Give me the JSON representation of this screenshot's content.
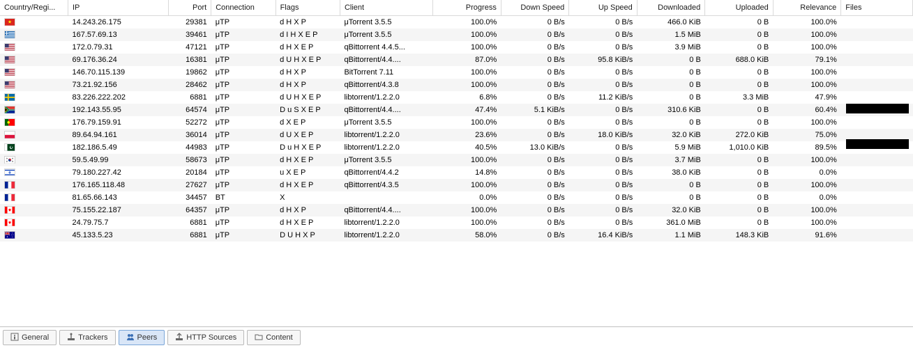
{
  "columns": [
    {
      "key": "country",
      "label": "Country/Regi...",
      "align": "left",
      "width": 95
    },
    {
      "key": "ip",
      "label": "IP",
      "align": "left",
      "width": 140
    },
    {
      "key": "port",
      "label": "Port",
      "align": "right",
      "width": 60
    },
    {
      "key": "connection",
      "label": "Connection",
      "align": "left",
      "width": 90
    },
    {
      "key": "flags",
      "label": "Flags",
      "align": "left",
      "width": 90
    },
    {
      "key": "client",
      "label": "Client",
      "align": "left",
      "width": 130
    },
    {
      "key": "progress",
      "label": "Progress",
      "align": "right",
      "width": 95
    },
    {
      "key": "down",
      "label": "Down Speed",
      "align": "right",
      "width": 95
    },
    {
      "key": "up",
      "label": "Up Speed",
      "align": "right",
      "width": 95
    },
    {
      "key": "downloaded",
      "label": "Downloaded",
      "align": "right",
      "width": 95
    },
    {
      "key": "uploaded",
      "label": "Uploaded",
      "align": "right",
      "width": 95
    },
    {
      "key": "relevance",
      "label": "Relevance",
      "align": "right",
      "width": 95
    },
    {
      "key": "files",
      "label": "Files",
      "align": "left",
      "width": 100
    }
  ],
  "rows": [
    {
      "flag": "vn",
      "ip": "14.243.26.175",
      "port": "29381",
      "connection": "μTP",
      "flags": "d H X P",
      "client": "μTorrent 3.5.5",
      "progress": "100.0%",
      "down": "0 B/s",
      "up": "0 B/s",
      "downloaded": "466.0 KiB",
      "uploaded": "0 B",
      "relevance": "100.0%",
      "files": ""
    },
    {
      "flag": "gr",
      "ip": "167.57.69.13",
      "port": "39461",
      "connection": "μTP",
      "flags": "d I H X E P",
      "client": "μTorrent 3.5.5",
      "progress": "100.0%",
      "down": "0 B/s",
      "up": "0 B/s",
      "downloaded": "1.5 MiB",
      "uploaded": "0 B",
      "relevance": "100.0%",
      "files": ""
    },
    {
      "flag": "us",
      "ip": "172.0.79.31",
      "port": "47121",
      "connection": "μTP",
      "flags": "d H X E P",
      "client": "qBittorrent 4.4.5...",
      "progress": "100.0%",
      "down": "0 B/s",
      "up": "0 B/s",
      "downloaded": "3.9 MiB",
      "uploaded": "0 B",
      "relevance": "100.0%",
      "files": ""
    },
    {
      "flag": "us",
      "ip": "69.176.36.24",
      "port": "16381",
      "connection": "μTP",
      "flags": "d U H X E P",
      "client": "qBittorrent/4.4....",
      "progress": "87.0%",
      "down": "0 B/s",
      "up": "95.8 KiB/s",
      "downloaded": "0 B",
      "uploaded": "688.0 KiB",
      "relevance": "79.1%",
      "files": ""
    },
    {
      "flag": "us",
      "ip": "146.70.115.139",
      "port": "19862",
      "connection": "μTP",
      "flags": "d H X P",
      "client": "BitTorrent 7.11",
      "progress": "100.0%",
      "down": "0 B/s",
      "up": "0 B/s",
      "downloaded": "0 B",
      "uploaded": "0 B",
      "relevance": "100.0%",
      "files": ""
    },
    {
      "flag": "us",
      "ip": "73.21.92.156",
      "port": "28462",
      "connection": "μTP",
      "flags": "d H X P",
      "client": "qBittorrent/4.3.8",
      "progress": "100.0%",
      "down": "0 B/s",
      "up": "0 B/s",
      "downloaded": "0 B",
      "uploaded": "0 B",
      "relevance": "100.0%",
      "files": ""
    },
    {
      "flag": "se",
      "ip": "83.226.222.202",
      "port": "6881",
      "connection": "μTP",
      "flags": "d U H X E P",
      "client": "libtorrent/1.2.2.0",
      "progress": "6.8%",
      "down": "0 B/s",
      "up": "11.2 KiB/s",
      "downloaded": "0 B",
      "uploaded": "3.3 MiB",
      "relevance": "47.9%",
      "files": ""
    },
    {
      "flag": "za",
      "ip": "192.143.55.95",
      "port": "64574",
      "connection": "μTP",
      "flags": "D u S X E P",
      "client": "qBittorrent/4.4....",
      "progress": "47.4%",
      "down": "5.1 KiB/s",
      "up": "0 B/s",
      "downloaded": "310.6 KiB",
      "uploaded": "0 B",
      "relevance": "60.4%",
      "files": ""
    },
    {
      "flag": "pt",
      "ip": "176.79.159.91",
      "port": "52272",
      "connection": "μTP",
      "flags": "d X E P",
      "client": "μTorrent 3.5.5",
      "progress": "100.0%",
      "down": "0 B/s",
      "up": "0 B/s",
      "downloaded": "0 B",
      "uploaded": "0 B",
      "relevance": "100.0%",
      "files": ""
    },
    {
      "flag": "pl",
      "ip": "89.64.94.161",
      "port": "36014",
      "connection": "μTP",
      "flags": "d U X E P",
      "client": "libtorrent/1.2.2.0",
      "progress": "23.6%",
      "down": "0 B/s",
      "up": "18.0 KiB/s",
      "downloaded": "32.0 KiB",
      "uploaded": "272.0 KiB",
      "relevance": "75.0%",
      "files": ""
    },
    {
      "flag": "pk",
      "ip": "182.186.5.49",
      "port": "44983",
      "connection": "μTP",
      "flags": "D u H X E P",
      "client": "libtorrent/1.2.2.0",
      "progress": "40.5%",
      "down": "13.0 KiB/s",
      "up": "0 B/s",
      "downloaded": "5.9 MiB",
      "uploaded": "1,010.0 KiB",
      "relevance": "89.5%",
      "files": ""
    },
    {
      "flag": "kr",
      "ip": "59.5.49.99",
      "port": "58673",
      "connection": "μTP",
      "flags": "d H X E P",
      "client": "μTorrent 3.5.5",
      "progress": "100.0%",
      "down": "0 B/s",
      "up": "0 B/s",
      "downloaded": "3.7 MiB",
      "uploaded": "0 B",
      "relevance": "100.0%",
      "files": ""
    },
    {
      "flag": "il",
      "ip": "79.180.227.42",
      "port": "20184",
      "connection": "μTP",
      "flags": "u X E P",
      "client": "qBittorrent/4.4.2",
      "progress": "14.8%",
      "down": "0 B/s",
      "up": "0 B/s",
      "downloaded": "38.0 KiB",
      "uploaded": "0 B",
      "relevance": "0.0%",
      "files": ""
    },
    {
      "flag": "fr",
      "ip": "176.165.118.48",
      "port": "27627",
      "connection": "μTP",
      "flags": "d H X E P",
      "client": "qBittorrent/4.3.5",
      "progress": "100.0%",
      "down": "0 B/s",
      "up": "0 B/s",
      "downloaded": "0 B",
      "uploaded": "0 B",
      "relevance": "100.0%",
      "files": ""
    },
    {
      "flag": "fr",
      "ip": "81.65.66.143",
      "port": "34457",
      "connection": "BT",
      "flags": "X",
      "client": "",
      "progress": "0.0%",
      "down": "0 B/s",
      "up": "0 B/s",
      "downloaded": "0 B",
      "uploaded": "0 B",
      "relevance": "0.0%",
      "files": ""
    },
    {
      "flag": "ca",
      "ip": "75.155.22.187",
      "port": "64357",
      "connection": "μTP",
      "flags": "d H X P",
      "client": "qBittorrent/4.4....",
      "progress": "100.0%",
      "down": "0 B/s",
      "up": "0 B/s",
      "downloaded": "32.0 KiB",
      "uploaded": "0 B",
      "relevance": "100.0%",
      "files": ""
    },
    {
      "flag": "ca",
      "ip": "24.79.75.7",
      "port": "6881",
      "connection": "μTP",
      "flags": "d H X E P",
      "client": "libtorrent/1.2.2.0",
      "progress": "100.0%",
      "down": "0 B/s",
      "up": "0 B/s",
      "downloaded": "361.0 MiB",
      "uploaded": "0 B",
      "relevance": "100.0%",
      "files": ""
    },
    {
      "flag": "au",
      "ip": "45.133.5.23",
      "port": "6881",
      "connection": "μTP",
      "flags": "D U H X P",
      "client": "libtorrent/1.2.2.0",
      "progress": "58.0%",
      "down": "0 B/s",
      "up": "16.4 KiB/s",
      "downloaded": "1.1 MiB",
      "uploaded": "148.3 KiB",
      "relevance": "91.6%",
      "files": ""
    }
  ],
  "tabs": [
    {
      "id": "general",
      "label": "General",
      "icon": "info",
      "active": false
    },
    {
      "id": "trackers",
      "label": "Trackers",
      "icon": "tracker",
      "active": false
    },
    {
      "id": "peers",
      "label": "Peers",
      "icon": "peers",
      "active": true
    },
    {
      "id": "http",
      "label": "HTTP Sources",
      "icon": "http",
      "active": false
    },
    {
      "id": "content",
      "label": "Content",
      "icon": "folder",
      "active": false
    }
  ],
  "flag_svgs": {
    "vn": "<svg viewBox='0 0 16 11'><rect width='16' height='11' fill='#da251d'/><polygon points='8,2 8.7,4.1 10.9,4.1 9.1,5.4 9.8,7.5 8,6.2 6.2,7.5 6.9,5.4 5.1,4.1 7.3,4.1' fill='#ff0'/></svg>",
    "gr": "<svg viewBox='0 0 16 11'><rect width='16' height='11' fill='#0d5eaf'/><rect y='1.22' width='16' height='1.22' fill='#fff'/><rect y='3.66' width='16' height='1.22' fill='#fff'/><rect y='6.11' width='16' height='1.22' fill='#fff'/><rect y='8.55' width='16' height='1.22' fill='#fff'/><rect width='6' height='6.1' fill='#0d5eaf'/><rect x='2.4' width='1.2' height='6.1' fill='#fff'/><rect y='2.44' width='6' height='1.22' fill='#fff'/></svg>",
    "us": "<svg viewBox='0 0 16 11'><rect width='16' height='11' fill='#b22234'/><g fill='#fff'><rect y='0.85' width='16' height='0.85'/><rect y='2.54' width='16' height='0.85'/><rect y='4.23' width='16' height='0.85'/><rect y='5.92' width='16' height='0.85'/><rect y='7.61' width='16' height='0.85'/><rect y='9.3' width='16' height='0.85'/></g><rect width='6.4' height='5.92' fill='#3c3b6e'/></svg>",
    "se": "<svg viewBox='0 0 16 11'><rect width='16' height='11' fill='#006aa7'/><rect x='4.5' width='2' height='11' fill='#fecc00'/><rect y='4.5' width='16' height='2' fill='#fecc00'/></svg>",
    "za": "<svg viewBox='0 0 16 11'><rect width='16' height='5.5' fill='#de3831'/><rect y='5.5' width='16' height='5.5' fill='#002395'/><polygon points='0,0 7,5.5 0,11' fill='#000'/><path d='M0,0 L6,5.5 L0,11' fill='none' stroke='#ffb612' stroke-width='1.2'/><path d='M0,1 L5.2,5.5 L0,10 M0,0 L16,0 M0,11 L16,11' fill='none'/><path d='M0,0.5 L6.5,5.5 L0,10.5 L0,11 L16,11 L16,7 L8,7 L2,2 L16,2 L16,0 Z' fill='none'/><path d='M0,0 L7,5.5 L16,5.5' stroke='#007a4d' stroke-width='2.2' fill='none'/><path d='M0,11 L7,5.5' stroke='#007a4d' stroke-width='2.2' fill='none'/><path d='M0,0 L7,5.5 L16,5.5' stroke='#fff' stroke-width='3.6' fill='none' stroke-linejoin='miter' opacity='0'/><rect y='4.4' width='16' height='2.2' fill='#007a4d'/><polygon points='0,1.3 5.3,5.5 0,9.7' fill='#007a4d'/><polygon points='0,2.3 4,5.5 0,8.7' fill='#000'/><polygon points='0,1.8 4.5,5.5 0,9.2' fill='none' stroke='#ffb612' stroke-width='0.7'/><path d='M0,0 L16,0 L16,4.4 L7.5,4.4 L2,0 Z' fill='#de3831'/><path d='M0,11 L16,11 L16,6.6 L7.5,6.6 L2,11 Z' fill='#002395'/><path d='M0,0 L1,0 L7,4.8 L16,4.8 L16,4.4 L7.5,4.4 Z' fill='#fff'/><path d='M0,11 L1,11 L7,6.2 L16,6.2 L16,6.6 L7.5,6.6 Z' fill='#fff'/></svg>",
    "pt": "<svg viewBox='0 0 16 11'><rect width='6' height='11' fill='#006600'/><rect x='6' width='10' height='11' fill='#ff0000'/><circle cx='6' cy='5.5' r='2.2' fill='#ff0' stroke='#000' stroke-width='0.2'/></svg>",
    "pl": "<svg viewBox='0 0 16 11'><rect width='16' height='5.5' fill='#fff'/><rect y='5.5' width='16' height='5.5' fill='#dc143c'/></svg>",
    "pk": "<svg viewBox='0 0 16 11'><rect width='16' height='11' fill='#01411c'/><rect width='4' height='11' fill='#fff'/><circle cx='10.5' cy='5.5' r='2.5' fill='#fff'/><circle cx='11.3' cy='5' r='2.1' fill='#01411c'/><polygon points='12.5,4 13,5 14,5.2 13.2,5.8 13.5,6.8 12.5,6.2 11.5,6.8 11.8,5.8 11,5.2 12,5' fill='#fff' transform='scale(0.7) translate(5,2)'/></svg>",
    "kr": "<svg viewBox='0 0 16 11'><rect width='16' height='11' fill='#fff'/><circle cx='8' cy='5.5' r='2.3' fill='#cd2e3a'/><path d='M5.7,5.5 A2.3,2.3 0 0 0 10.3,5.5 A1.15,1.15 0 0 1 8,5.5 A1.15,1.15 0 0 0 5.7,5.5' fill='#0047a0'/><g stroke='#000' stroke-width='0.4'><line x1='3' y1='2' x2='4.5' y2='3.2'/><line x1='2.6' y1='2.5' x2='4.1' y2='3.7'/><line x1='2.2' y1='3' x2='3.7' y2='4.2'/><line x1='11.5' y1='3.2' x2='13' y2='2'/><line x1='11.9' y1='3.7' x2='13.4' y2='2.5'/><line x1='12.3' y1='4.2' x2='13.8' y2='3'/><line x1='3' y1='9' x2='4.5' y2='7.8'/><line x1='2.6' y1='8.5' x2='4.1' y2='7.3'/><line x1='2.2' y1='8' x2='3.7' y2='6.8'/><line x1='11.5' y1='7.8' x2='13' y2='9'/><line x1='11.9' y1='7.3' x2='13.4' y2='8.5'/><line x1='12.3' y1='6.8' x2='13.8' y2='8'/></g></svg>",
    "il": "<svg viewBox='0 0 16 11'><rect width='16' height='11' fill='#fff'/><rect y='1' width='16' height='1.5' fill='#0038b8'/><rect y='8.5' width='16' height='1.5' fill='#0038b8'/><polygon points='8,3.2 9.5,6 6.5,6' fill='none' stroke='#0038b8' stroke-width='0.5'/><polygon points='8,7.8 6.5,5 9.5,5' fill='none' stroke='#0038b8' stroke-width='0.5'/></svg>",
    "fr": "<svg viewBox='0 0 16 11'><rect width='5.33' height='11' fill='#002395'/><rect x='5.33' width='5.34' height='11' fill='#fff'/><rect x='10.67' width='5.33' height='11' fill='#ed2939'/></svg>",
    "ca": "<svg viewBox='0 0 16 11'><rect width='16' height='11' fill='#ff0000'/><rect x='4' width='8' height='11' fill='#fff'/><polygon points='8,2.5 8.5,4 9.8,3.5 9.3,5 10.5,5.3 9,6.3 9.3,7.5 8,6.8 6.7,7.5 7,6.3 5.5,5.3 6.7,5 6.2,3.5 7.5,4' fill='#ff0000'/></svg>",
    "au": "<svg viewBox='0 0 16 11'><rect width='16' height='11' fill='#00008b'/><rect width='8' height='5.5' fill='#00008b'/><path d='M0,0 L8,5.5 M8,0 L0,5.5' stroke='#fff' stroke-width='1.1'/><path d='M0,0 L8,5.5 M8,0 L0,5.5' stroke='#c00' stroke-width='0.6'/><path d='M4,0 V5.5 M0,2.75 H8' stroke='#fff' stroke-width='1.6'/><path d='M4,0 V5.5 M0,2.75 H8' stroke='#c00' stroke-width='0.9'/><g fill='#fff'><polygon points='4,7 4.3,7.9 5.2,7.9 4.45,8.45 4.75,9.35 4,8.8 3.25,9.35 3.55,8.45 2.8,7.9 3.7,7.9'/><circle cx='12' cy='2' r='0.5'/><circle cx='13.5' cy='4.5' r='0.5'/><circle cx='11' cy='5' r='0.5'/><circle cx='12' cy='8.5' r='0.5'/><circle cx='12.7' cy='6' r='0.3'/></g></svg>"
  },
  "tab_icons": {
    "info": "<svg viewBox='0 0 12 12'><rect x='1' y='1' width='10' height='10' fill='none' stroke='#666' stroke-width='1'/><rect x='5' y='3' width='2' height='1.5' fill='#666'/><rect x='5' y='5.5' width='2' height='4' fill='#666'/></svg>",
    "tracker": "<svg viewBox='0 0 12 12'><rect x='1' y='8' width='10' height='3' fill='#666'/><rect x='5.3' y='1' width='1.4' height='7' fill='#666'/><circle cx='6' cy='2' r='1.5' fill='#666'/></svg>",
    "peers": "<svg viewBox='0 0 12 12'><circle cx='4' cy='4' r='2' fill='#3a6fb5'/><circle cx='8' cy='4' r='2' fill='#3a6fb5'/><path d='M1,11 C1,8 4,7 4,7 C4,7 7,8 7,11 Z' fill='#3a6fb5'/><path d='M5,11 C5,8 8,7 8,7 C8,7 11,8 11,11 Z' fill='#3a6fb5'/></svg>",
    "http": "<svg viewBox='0 0 12 12'><rect x='1' y='8' width='10' height='3' fill='#666'/><rect x='5.3' y='1' width='1.4' height='7' fill='#666'/><path d='M3,4 L6,1 L9,4' fill='none' stroke='#666' stroke-width='1.3'/></svg>",
    "folder": "<svg viewBox='0 0 12 12'><path d='M1,3 L5,3 L6,4 L11,4 L11,10 L1,10 Z' fill='none' stroke='#666' stroke-width='1'/></svg>"
  }
}
